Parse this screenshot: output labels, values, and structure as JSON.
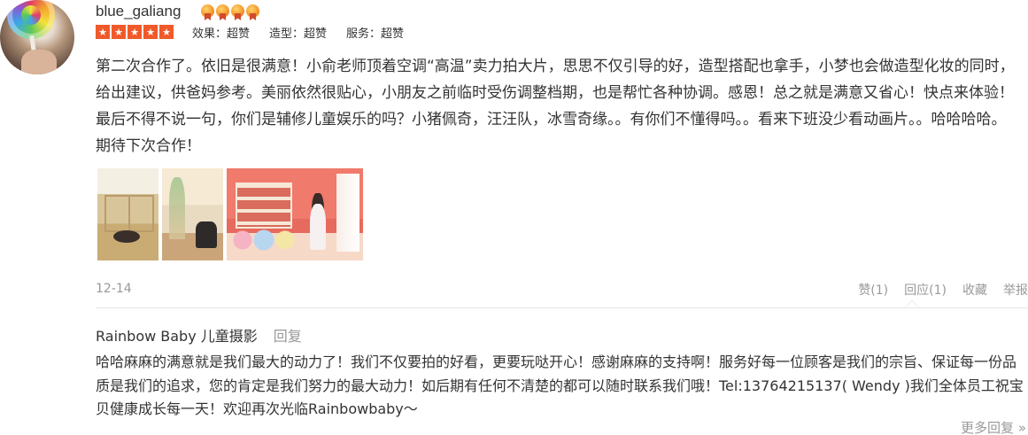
{
  "user": {
    "name": "blue_galiang",
    "medal_count": 4
  },
  "rating": {
    "stars": 5,
    "scores": [
      {
        "label": "效果：超赞"
      },
      {
        "label": "造型：超赞"
      },
      {
        "label": "服务：超赞"
      }
    ]
  },
  "review": {
    "text": "第二次合作了。依旧是很满意！小俞老师顶着空调“高温”卖力拍大片，思思不仅引导的好，造型搭配也拿手，小梦也会做造型化妆的同时，给出建议，供爸妈参考。美丽依然很贴心，小朋友之前临时受伤调整档期，也是帮忙各种协调。感恩！总之就是满意又省心！快点来体验！最后不得不说一句，你们是辅修儿童娱乐的吗？小猪佩奇，汪汪队，冰雪奇缘。。有你们不懂得吗。。看来下班没少看动画片。。哈哈哈哈。期待下次合作！",
    "date": "12-14"
  },
  "actions": {
    "like": "赞(1)",
    "reply": "回应(1)",
    "favorite": "收藏",
    "report": "举报"
  },
  "merchant_reply": {
    "author": "Rainbow Baby 儿童摄影",
    "reply_label": "回复",
    "text": "哈哈麻麻的满意就是我们最大的动力了！我们不仅要拍的好看，更要玩哒开心！感谢麻麻的支持啊！服务好每一位顾客是我们的宗旨、保证每一份品质是我们的追求，您的肯定是我们努力的最大动力！如后期有任何不清楚的都可以随时联系我们哦！Tel:13764215137( Wendy )我们全体员工祝宝贝健康成长每一天！欢迎再次光临Rainbowbaby～"
  },
  "more_replies": "更多回复 »",
  "colors": {
    "star": "#f05a2a",
    "muted": "#999999",
    "text": "#333333",
    "divider": "#e5e5e5"
  }
}
